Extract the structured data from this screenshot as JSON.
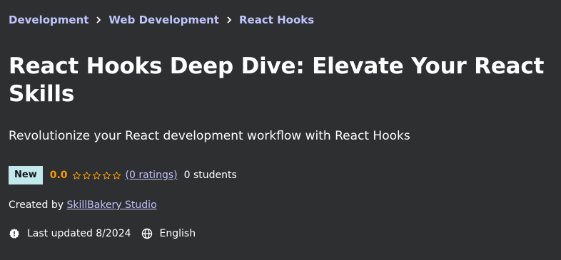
{
  "breadcrumb": {
    "items": [
      {
        "label": "Development"
      },
      {
        "label": "Web Development"
      },
      {
        "label": "React Hooks"
      }
    ]
  },
  "course": {
    "title": "React Hooks Deep Dive: Elevate Your React Skills",
    "subtitle": "Revolutionize your React development workflow with React Hooks",
    "badge": "New",
    "rating": "0.0",
    "rating_fraction": 0,
    "ratings_link": "(0 ratings)",
    "students": "0 students",
    "created_by_prefix": "Created by",
    "creator": "SkillBakery Studio",
    "last_updated": "Last updated 8/2024",
    "language": "English"
  },
  "icons": {
    "breadcrumb_separator": "chevron-right-icon",
    "star": "star-outline-icon",
    "update": "alert-badge-icon",
    "language": "globe-icon"
  },
  "colors": {
    "background": "#2d2f31",
    "link": "#c0c4fc",
    "rating": "#f69c08",
    "badge_bg": "#c2e9eb",
    "text": "#ffffff"
  }
}
